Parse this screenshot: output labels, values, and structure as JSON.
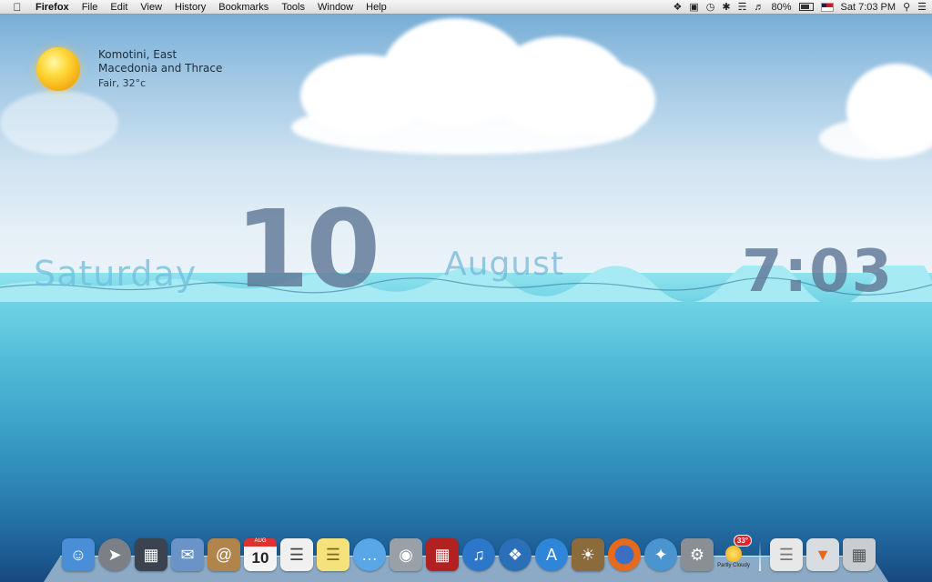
{
  "menubar": {
    "apple_icon": "apple-icon",
    "app_name": "Firefox",
    "menus": [
      "File",
      "Edit",
      "View",
      "History",
      "Bookmarks",
      "Tools",
      "Window",
      "Help"
    ],
    "battery": "80%",
    "clock": "Sat 7:03 PM",
    "status_icons": [
      "script-icon",
      "display-icon",
      "time-machine-icon",
      "bluetooth-icon",
      "wifi-icon",
      "volume-icon",
      "battery-icon",
      "flag-icon",
      "spotlight-icon",
      "list-icon"
    ]
  },
  "weather": {
    "location_line1": "Komotini, East",
    "location_line2": "Macedonia and Thrace",
    "condition": "Fair, 32°c",
    "icon": "sun-icon"
  },
  "clock_widget": {
    "day_name": "Saturday",
    "day_number": "10",
    "month": "August",
    "time": "7:03"
  },
  "dock": {
    "items": [
      {
        "name": "Finder",
        "icon": "finder-icon",
        "color": "#4a8ed8"
      },
      {
        "name": "Launchpad",
        "icon": "launchpad-icon",
        "color": "#7d7f86"
      },
      {
        "name": "Mission Control",
        "icon": "mission-control-icon",
        "color": "#3b4250"
      },
      {
        "name": "Mail",
        "icon": "mail-icon",
        "color": "#6a94c8"
      },
      {
        "name": "Contacts",
        "icon": "contacts-icon",
        "color": "#b0844a"
      },
      {
        "name": "Calendar",
        "icon": "calendar-icon",
        "color": "#f4f4f4",
        "month_short": "AUG",
        "day": "10"
      },
      {
        "name": "Reminders",
        "icon": "reminders-icon",
        "color": "#f0f0f0"
      },
      {
        "name": "Notes",
        "icon": "notes-icon",
        "color": "#f5e27a"
      },
      {
        "name": "Messages",
        "icon": "messages-icon",
        "color": "#5aa7e8"
      },
      {
        "name": "FaceTime",
        "icon": "facetime-icon",
        "color": "#9aa0a8"
      },
      {
        "name": "Photo Booth",
        "icon": "photo-booth-icon",
        "color": "#b32020"
      },
      {
        "name": "iTunes",
        "icon": "itunes-icon",
        "color": "#2c77c9"
      },
      {
        "name": "Dashboard",
        "icon": "dashboard-icon",
        "color": "#2a6fb8"
      },
      {
        "name": "App Store",
        "icon": "app-store-icon",
        "color": "#2f86d8"
      },
      {
        "name": "iPhoto",
        "icon": "iphoto-icon",
        "color": "#8b6a3c"
      },
      {
        "name": "Firefox",
        "icon": "firefox-icon",
        "color": "#e66a1c"
      },
      {
        "name": "Safari",
        "icon": "safari-icon",
        "color": "#4a95d0"
      },
      {
        "name": "System Preferences",
        "icon": "system-preferences-icon",
        "color": "#8a8f96"
      }
    ],
    "weather_item": {
      "label": "Partly Cloudy",
      "badge": "33°",
      "icon": "partly-cloudy-icon"
    },
    "right_items": [
      {
        "name": "Documents",
        "icon": "document-icon",
        "color": "#e8e8e8"
      },
      {
        "name": "Downloads",
        "icon": "downloads-icon",
        "color": "#d8dde2"
      },
      {
        "name": "Trash",
        "icon": "trash-icon",
        "color": "#c9cdd2"
      }
    ]
  }
}
